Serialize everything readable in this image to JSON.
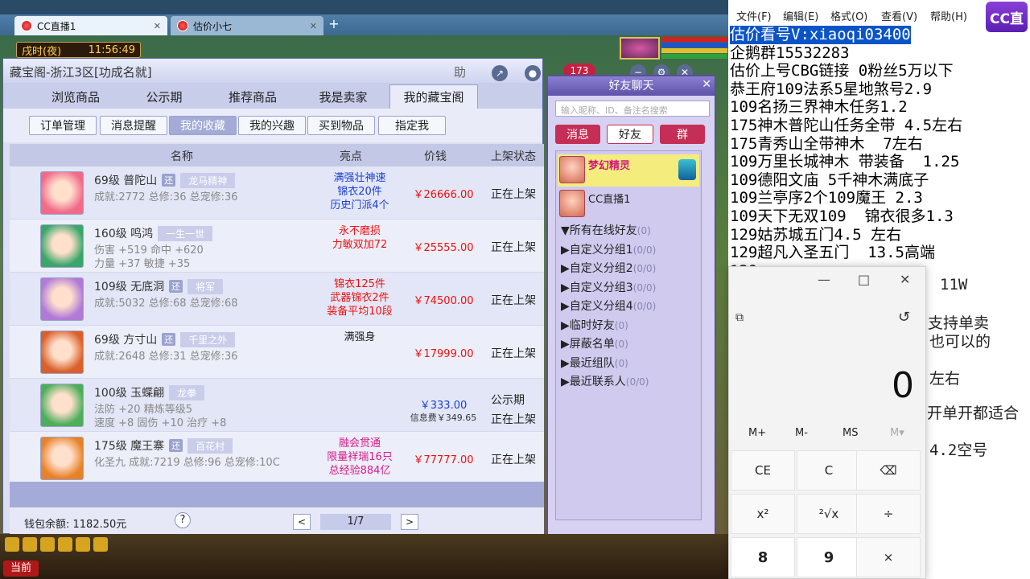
{
  "browser": {
    "tabs": [
      {
        "label": "CC直播1"
      },
      {
        "label": "估价小七"
      }
    ],
    "new_tab": "+"
  },
  "game": {
    "time_label": "戌时(夜)",
    "clock": "11:56:49",
    "current_button": "当前"
  },
  "cbg": {
    "title": "藏宝阁-浙江3区[功成名就]",
    "help_label": "助",
    "notif_count": "173",
    "nav_tabs": [
      "浏览商品",
      "公示期",
      "推荐商品",
      "我是卖家",
      "我的藏宝阁"
    ],
    "active_nav": "我的藏宝阁",
    "sub_tabs": [
      "订单管理",
      "消息提醒",
      "我的收藏",
      "我的兴趣",
      "买到物品",
      "指定我"
    ],
    "active_sub": "我的收藏",
    "columns": {
      "name": "名称",
      "highlight": "亮点",
      "price": "价钱",
      "status": "上架状态"
    },
    "rows": [
      {
        "level_name": "69级 普陀山",
        "badge": "还",
        "tag": "龙马精神",
        "line2": "成就:2772 总修:36 总宠修:36",
        "line3": "",
        "highlights": [
          "满强壮神速",
          "锦衣20件",
          "历史门派4个"
        ],
        "hl_color": "#1a3fd6",
        "price": "￥26666.00",
        "price_note": "",
        "status": "正在上架",
        "status2": "",
        "avatar": "#f06a8a"
      },
      {
        "level_name": "160级 鸣鸿",
        "badge": "",
        "tag": "一生一世",
        "line2": "伤害 +519 命中 +620",
        "line3": "力量 +37 敏捷 +35",
        "highlights": [
          "永不磨损",
          "力敏双加72"
        ],
        "hl_color": "#e11",
        "price": "￥25555.00",
        "price_note": "",
        "status": "正在上架",
        "status2": "",
        "avatar": "#3aa66a"
      },
      {
        "level_name": "109级 无底洞",
        "badge": "还",
        "tag": "将军",
        "line2": "成就:5032 总修:68 总宠修:68",
        "line3": "",
        "highlights": [
          "锦衣125件",
          "武器锦衣2件",
          "装备平均10段"
        ],
        "hl_color": "#e11",
        "price": "￥74500.00",
        "price_note": "",
        "status": "正在上架",
        "status2": "",
        "avatar": "#b07ad6"
      },
      {
        "level_name": "69级 方寸山",
        "badge": "还",
        "tag": "千里之外",
        "line2": "成就:2648 总修:31 总宠修:36",
        "line3": "",
        "highlights": [
          "满强身"
        ],
        "hl_color": "#222",
        "price": "￥17999.00",
        "price_note": "",
        "status": "正在上架",
        "status2": "",
        "avatar": "#d9602a"
      },
      {
        "level_name": "100级 玉蝶翩",
        "badge": "",
        "tag": "龙拳",
        "line2": "法防 +20 精炼等级5",
        "line3": "速度 +8 固伤 +10 治疗 +8",
        "highlights": [],
        "hl_color": "#222",
        "price": "￥333.00",
        "price_note": "信息费￥349.65",
        "status": "公示期",
        "status2": "正在上架",
        "avatar": "#4cae5a"
      },
      {
        "level_name": "175级 魔王寨",
        "badge": "还",
        "tag": "百花村",
        "line2": "化圣九 成就:7219 总修:96 总宠修:10C",
        "line3": "",
        "highlights": [
          "融会贯通",
          "限量祥瑞16只",
          "总经验884亿"
        ],
        "hl_color": "#d81b8a",
        "price": "￥77777.00",
        "price_note": "",
        "status": "正在上架",
        "status2": "",
        "avatar": "#e8822a"
      }
    ],
    "wallet": "钱包余额: 1182.50元",
    "help_q": "?",
    "page": "1/7",
    "prev": "<",
    "next": ">"
  },
  "chat": {
    "title": "好友聊天",
    "search_placeholder": "输入昵称、ID、备注名搜索",
    "tabs": [
      "消息",
      "好友",
      "群"
    ],
    "active_tab": "好友",
    "friends": [
      {
        "name": "梦幻精灵"
      },
      {
        "name": "CC直播1"
      }
    ],
    "groups": [
      {
        "name": "▼所有在线好友",
        "count": "(0)"
      },
      {
        "name": "▶自定义分组1",
        "count": "(0/0)"
      },
      {
        "name": "▶自定义分组2",
        "count": "(0/0)"
      },
      {
        "name": "▶自定义分组3",
        "count": "(0/0)"
      },
      {
        "name": "▶自定义分组4",
        "count": "(0/0)"
      },
      {
        "name": "▶临时好友",
        "count": "(0)"
      },
      {
        "name": "▶屏蔽名单",
        "count": "(0)"
      },
      {
        "name": "▶最近组队",
        "count": "(0)"
      },
      {
        "name": "▶最近联系人",
        "count": "(0/0)"
      }
    ]
  },
  "notepad": {
    "menu": [
      "文件(F)",
      "编辑(E)",
      "格式(O)",
      "查看(V)",
      "帮助(H)"
    ],
    "logo": "CC直播",
    "lines": [
      "估价看号V:xiaoqi03400",
      "企鹅群15532283",
      "估价上号CBG链接 0粉丝5万以下",
      "恭王府109法系5星地煞号2.9",
      "109名扬三界神木任务1.2",
      "175神木普陀山任务全带 4.5左右",
      "175青秀山全带神木  7左右",
      "109万里长城神木 带装备  1.25",
      "109德阳文庙 5千神木满底子",
      "109兰亭序2个109魔王 2.3",
      "109天下无双109  锦衣很多1.3",
      "129姑苏城五门4.5 左右",
      "129超凡入圣五门  13.5高端"
    ],
    "fragments": [
      "11W",
      "支持单卖",
      "也可以的",
      "左右",
      "开单开都适合",
      "4.2空号"
    ]
  },
  "calculator": {
    "display": "0",
    "memory": [
      "M+",
      "M-",
      "MS",
      "M▾"
    ],
    "keys": [
      "CE",
      "C",
      "⌫",
      "x²",
      "²√x",
      "÷",
      "8",
      "9",
      "×"
    ]
  }
}
